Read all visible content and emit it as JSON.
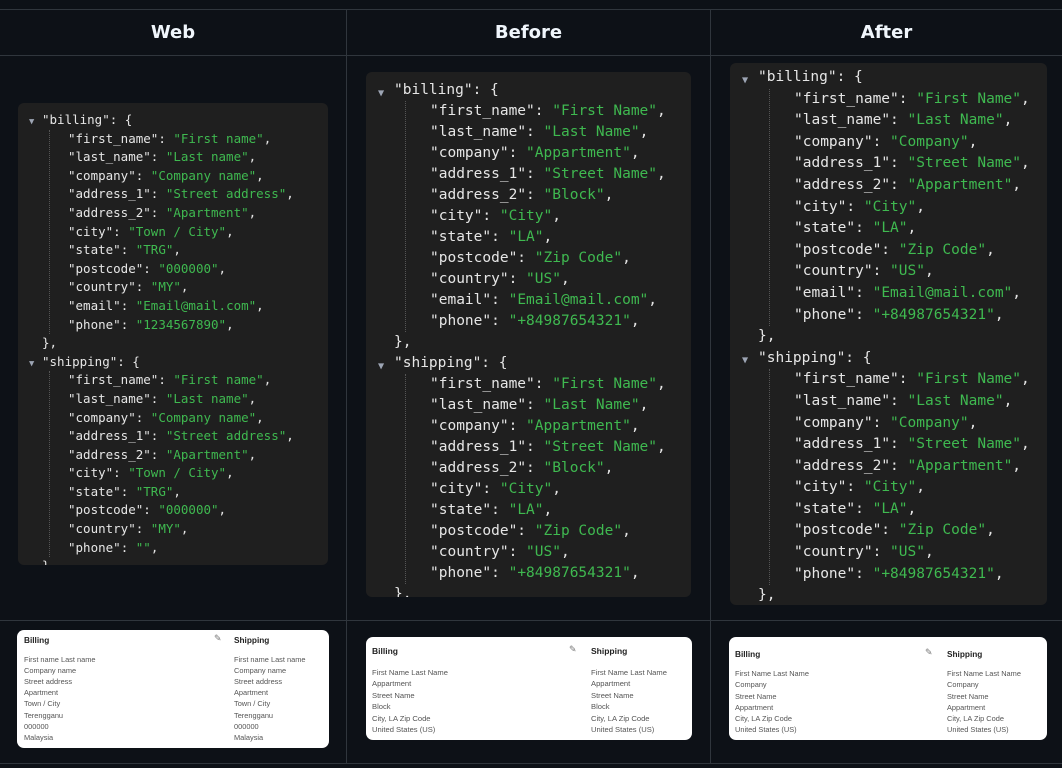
{
  "columns": [
    "Web",
    "Before",
    "After"
  ],
  "icons": {
    "collapse": "triangle-down-icon",
    "edit": "pencil-icon"
  },
  "colors": {
    "background": "#0d1117",
    "code_bg": "#1f1f1f",
    "string": "#3fb950",
    "key": "#e6e6e6"
  },
  "panels": [
    {
      "billing": {
        "header": "\"billing\": {",
        "fields": [
          [
            "first_name",
            "First name"
          ],
          [
            "last_name",
            "Last name"
          ],
          [
            "company",
            "Company name"
          ],
          [
            "address_1",
            "Street address"
          ],
          [
            "address_2",
            "Apartment"
          ],
          [
            "city",
            "Town / City"
          ],
          [
            "state",
            "TRG"
          ],
          [
            "postcode",
            "000000"
          ],
          [
            "country",
            "MY"
          ],
          [
            "email",
            "Email@mail.com"
          ],
          [
            "phone",
            "1234567890"
          ]
        ]
      },
      "shipping": {
        "header": "\"shipping\": {",
        "fields": [
          [
            "first_name",
            "First name"
          ],
          [
            "last_name",
            "Last name"
          ],
          [
            "company",
            "Company name"
          ],
          [
            "address_1",
            "Street address"
          ],
          [
            "address_2",
            "Apartment"
          ],
          [
            "city",
            "Town / City"
          ],
          [
            "state",
            "TRG"
          ],
          [
            "postcode",
            "000000"
          ],
          [
            "country",
            "MY"
          ],
          [
            "phone",
            ""
          ]
        ]
      },
      "card": {
        "billing_title": "Billing",
        "shipping_title": "Shipping",
        "billing_lines": [
          "First name Last name",
          "Company name",
          "Street address",
          "Apartment",
          "Town / City",
          "Terengganu",
          "000000",
          "Malaysia"
        ],
        "shipping_lines": [
          "First name Last name",
          "Company name",
          "Street address",
          "Apartment",
          "Town / City",
          "Terengganu",
          "000000",
          "Malaysia"
        ]
      }
    },
    {
      "billing": {
        "header": "\"billing\": {",
        "fields": [
          [
            "first_name",
            "First Name"
          ],
          [
            "last_name",
            "Last Name"
          ],
          [
            "company",
            "Appartment"
          ],
          [
            "address_1",
            "Street Name"
          ],
          [
            "address_2",
            "Block"
          ],
          [
            "city",
            "City"
          ],
          [
            "state",
            "LA"
          ],
          [
            "postcode",
            "Zip Code"
          ],
          [
            "country",
            "US"
          ],
          [
            "email",
            "Email@mail.com"
          ],
          [
            "phone",
            "+84987654321"
          ]
        ]
      },
      "shipping": {
        "header": "\"shipping\": {",
        "fields": [
          [
            "first_name",
            "First Name"
          ],
          [
            "last_name",
            "Last Name"
          ],
          [
            "company",
            "Appartment"
          ],
          [
            "address_1",
            "Street Name"
          ],
          [
            "address_2",
            "Block"
          ],
          [
            "city",
            "City"
          ],
          [
            "state",
            "LA"
          ],
          [
            "postcode",
            "Zip Code"
          ],
          [
            "country",
            "US"
          ],
          [
            "phone",
            "+84987654321"
          ]
        ]
      },
      "card": {
        "billing_title": "Billing",
        "shipping_title": "Shipping",
        "billing_lines": [
          "First Name Last Name",
          "Appartment",
          "Street Name",
          "Block",
          "City, LA Zip Code",
          "United States (US)"
        ],
        "shipping_lines": [
          "First Name Last Name",
          "Appartment",
          "Street Name",
          "Block",
          "City, LA Zip Code",
          "United States (US)"
        ]
      }
    },
    {
      "billing": {
        "header": "\"billing\": {",
        "fields": [
          [
            "first_name",
            "First Name"
          ],
          [
            "last_name",
            "Last Name"
          ],
          [
            "company",
            "Company"
          ],
          [
            "address_1",
            "Street Name"
          ],
          [
            "address_2",
            "Appartment"
          ],
          [
            "city",
            "City"
          ],
          [
            "state",
            "LA"
          ],
          [
            "postcode",
            "Zip Code"
          ],
          [
            "country",
            "US"
          ],
          [
            "email",
            "Email@mail.com"
          ],
          [
            "phone",
            "+84987654321"
          ]
        ]
      },
      "shipping": {
        "header": "\"shipping\": {",
        "fields": [
          [
            "first_name",
            "First Name"
          ],
          [
            "last_name",
            "Last Name"
          ],
          [
            "company",
            "Company"
          ],
          [
            "address_1",
            "Street Name"
          ],
          [
            "address_2",
            "Appartment"
          ],
          [
            "city",
            "City"
          ],
          [
            "state",
            "LA"
          ],
          [
            "postcode",
            "Zip Code"
          ],
          [
            "country",
            "US"
          ],
          [
            "phone",
            "+84987654321"
          ]
        ]
      },
      "card": {
        "billing_title": "Billing",
        "shipping_title": "Shipping",
        "billing_lines": [
          "First Name Last Name",
          "Company",
          "Street Name",
          "Appartment",
          "City, LA Zip Code",
          "United States (US)"
        ],
        "shipping_lines": [
          "First Name Last Name",
          "Company",
          "Street Name",
          "Appartment",
          "City, LA Zip Code",
          "United States (US)"
        ]
      }
    }
  ]
}
